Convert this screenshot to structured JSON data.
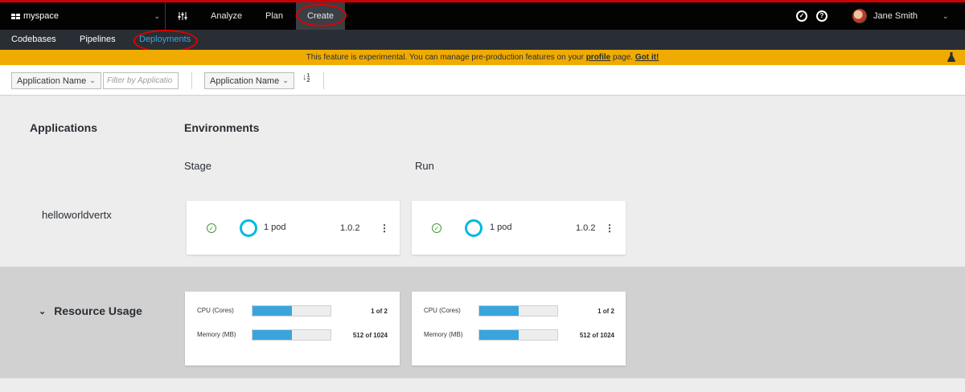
{
  "topnav": {
    "space": "myspace",
    "items": [
      {
        "label": "Analyze"
      },
      {
        "label": "Plan"
      },
      {
        "label": "Create"
      }
    ],
    "user": "Jane Smith"
  },
  "subnav": {
    "items": [
      {
        "label": "Codebases"
      },
      {
        "label": "Pipelines"
      },
      {
        "label": "Deployments"
      }
    ]
  },
  "banner": {
    "text_before": "This feature is experimental. You can manage pre-production features on your ",
    "link_profile": "profile",
    "text_middle": " page. ",
    "link_got_it": "Got it!"
  },
  "toolbar": {
    "filter_field": "Application Name",
    "filter_placeholder": "Filter by Applicatio",
    "sort_field": "Application Name",
    "sort_icon_top": "1",
    "sort_icon_bottom": "2"
  },
  "main": {
    "applications_heading": "Applications",
    "environments_heading": "Environments",
    "environments": [
      {
        "name": "Stage"
      },
      {
        "name": "Run"
      }
    ],
    "application": {
      "name": "helloworldvertx",
      "deployments": [
        {
          "env": "Stage",
          "pods": "1 pod",
          "version": "1.0.2"
        },
        {
          "env": "Run",
          "pods": "1 pod",
          "version": "1.0.2"
        }
      ]
    }
  },
  "resource_usage": {
    "title": "Resource Usage",
    "cards": [
      {
        "cpu_label": "CPU (Cores)",
        "cpu_value": "1 of 2",
        "cpu_fraction": 0.5,
        "mem_label": "Memory (MB)",
        "mem_value": "512 of 1024",
        "mem_fraction": 0.5
      },
      {
        "cpu_label": "CPU (Cores)",
        "cpu_value": "1 of 2",
        "cpu_fraction": 0.5,
        "mem_label": "Memory (MB)",
        "mem_value": "512 of 1024",
        "mem_fraction": 0.5
      }
    ]
  },
  "colors": {
    "accent": "#39a5dc",
    "banner": "#f0ab00",
    "ok": "#3f9c35",
    "pod_ring": "#00b9e4",
    "annotation": "#e00000"
  }
}
